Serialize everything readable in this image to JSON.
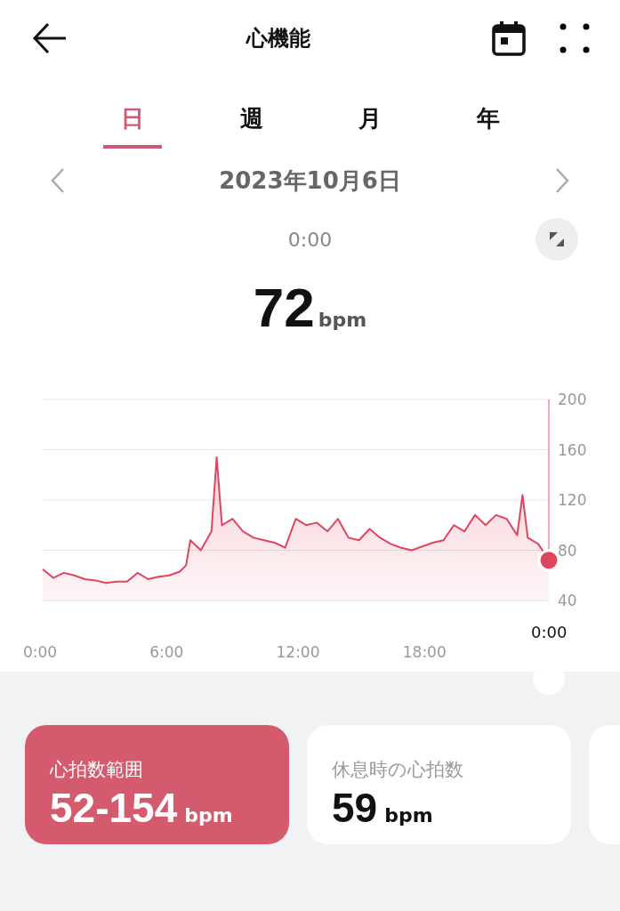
{
  "header": {
    "title": "心機能"
  },
  "tabs": [
    {
      "label": "日",
      "selected": true
    },
    {
      "label": "週",
      "selected": false
    },
    {
      "label": "月",
      "selected": false
    },
    {
      "label": "年",
      "selected": false
    }
  ],
  "date": "2023年10月6日",
  "reading": {
    "time": "0:00",
    "value": "72",
    "unit": "bpm"
  },
  "chart": {
    "cursor_label": "0:00",
    "chart_data": {
      "type": "area",
      "x": [
        0,
        0.5,
        1,
        1.5,
        2,
        2.5,
        3,
        3.5,
        4,
        4.5,
        5,
        5.5,
        6,
        6.5,
        6.8,
        7,
        7.5,
        8,
        8.25,
        8.5,
        9,
        9.5,
        10,
        10.5,
        11,
        11.5,
        12,
        12.5,
        13,
        13.5,
        14,
        14.5,
        15,
        15.5,
        16,
        16.5,
        17,
        17.5,
        18,
        18.5,
        19,
        19.5,
        20,
        20.5,
        21,
        21.5,
        22,
        22.5,
        22.75,
        23,
        23.5,
        24
      ],
      "grid": true,
      "series": [
        {
          "color": "#e0455f",
          "values": [
            65,
            58,
            62,
            60,
            57,
            56,
            54,
            55,
            55,
            62,
            57,
            59,
            60,
            63,
            68,
            88,
            80,
            95,
            154,
            100,
            105,
            95,
            90,
            88,
            86,
            82,
            105,
            100,
            102,
            95,
            105,
            90,
            88,
            97,
            90,
            85,
            82,
            80,
            83,
            86,
            88,
            100,
            95,
            108,
            100,
            108,
            105,
            92,
            124,
            90,
            85,
            72
          ]
        }
      ],
      "xlim": [
        0,
        24
      ],
      "ylim": [
        40,
        200
      ],
      "xticks": [
        {
          "value": 0,
          "label": "0:00"
        },
        {
          "value": 6,
          "label": "6:00"
        },
        {
          "value": 12,
          "label": "12:00"
        },
        {
          "value": 18,
          "label": "18:00"
        }
      ],
      "yticks": [
        40,
        80,
        120,
        160,
        200
      ]
    }
  },
  "cards": [
    {
      "label": "心拍数範囲",
      "value": "52-154",
      "unit": "bpm",
      "selected": true
    },
    {
      "label": "休息時の心拍数",
      "value": "59",
      "unit": "bpm",
      "selected": false
    },
    {
      "selected": false
    }
  ]
}
